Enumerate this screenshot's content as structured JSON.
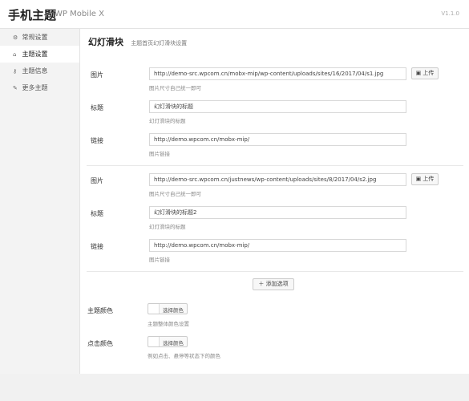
{
  "header": {
    "title": "手机主题",
    "subtitle": "WP Mobile X",
    "version": "V1.1.0"
  },
  "sidebar": {
    "items": [
      {
        "label": "常规设置",
        "icon": "gear-icon",
        "glyph": "⚙"
      },
      {
        "label": "主题设置",
        "icon": "home-icon",
        "glyph": "⌂"
      },
      {
        "label": "主题信息",
        "icon": "key-icon",
        "glyph": "⚷"
      },
      {
        "label": "更多主题",
        "icon": "pen-icon",
        "glyph": "✎"
      }
    ]
  },
  "section": {
    "title": "幻灯滑块",
    "description": "主题首页幻灯滑块设置"
  },
  "slides": [
    {
      "image_label": "图片",
      "image_value": "http://demo-src.wpcom.cn/mobx-mip/wp-content/uploads/sites/16/2017/04/s1.jpg",
      "image_hint": "图片尺寸自己统一即可",
      "upload_label": "上传",
      "title_label": "标题",
      "title_value": "幻灯滑块的标题",
      "title_hint": "幻灯滑块的标题",
      "link_label": "链接",
      "link_value": "http://demo.wpcom.cn/mobx-mip/",
      "link_hint": "图片链接"
    },
    {
      "image_label": "图片",
      "image_value": "http://demo-src.wpcom.cn/justnews/wp-content/uploads/sites/8/2017/04/s2.jpg",
      "image_hint": "图片尺寸自己统一即可",
      "upload_label": "上传",
      "title_label": "标题",
      "title_value": "幻灯滑块的标题2",
      "title_hint": "幻灯滑块的标题",
      "link_label": "链接",
      "link_value": "http://demo.wpcom.cn/mobx-mip/",
      "link_hint": "图片链接"
    }
  ],
  "add_option": {
    "label": "添加选项"
  },
  "theme_color": {
    "label": "主题颜色",
    "button": "选择颜色",
    "hint": "主题整体颜色设置"
  },
  "click_color": {
    "label": "点击颜色",
    "button": "选择颜色",
    "hint": "例如点击、悬停等状态下的颜色"
  }
}
